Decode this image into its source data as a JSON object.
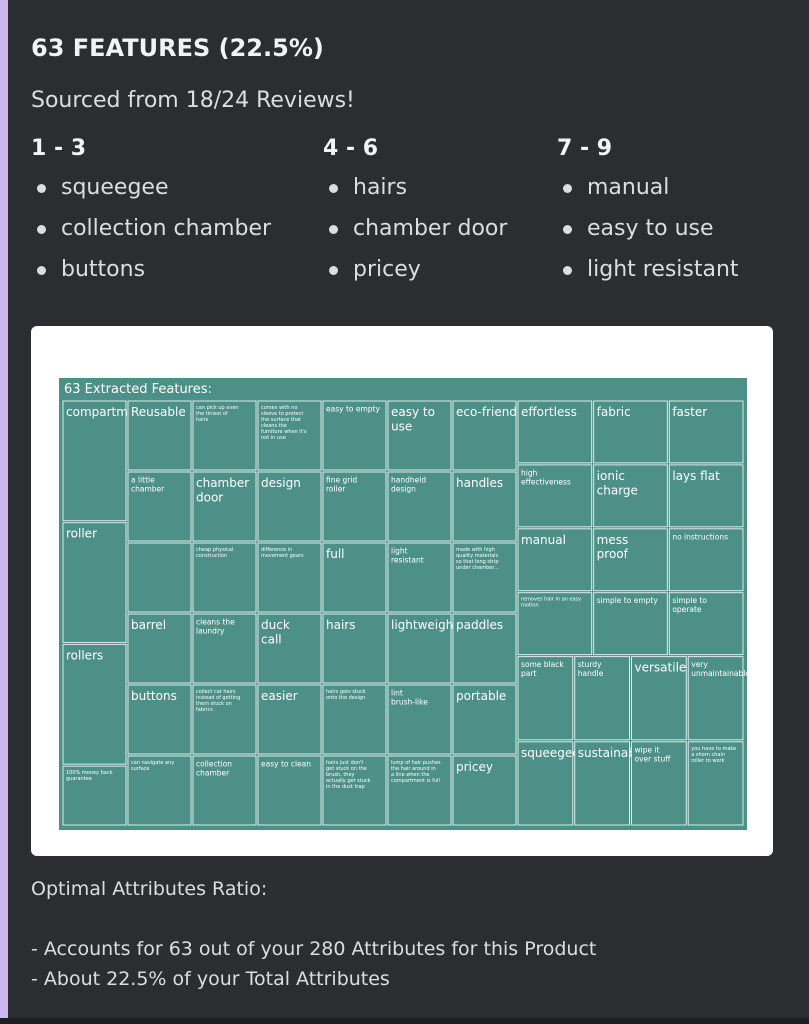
{
  "embed": {
    "title": "63 FEATURES (22.5%)",
    "subtitle": "Sourced from 18/24 Reviews!",
    "columns": [
      {
        "heading": "1 - 3",
        "items": [
          "squeegee",
          "collection chamber",
          "buttons"
        ]
      },
      {
        "heading": "4 - 6",
        "items": [
          "hairs",
          "chamber door",
          "pricey"
        ]
      },
      {
        "heading": "7 - 9",
        "items": [
          "manual",
          "easy to use",
          "light resistant"
        ]
      }
    ],
    "footer": {
      "heading": "Optimal Attributes Ratio:",
      "lines": [
        "- Accounts for 63 out of your 280 Attributes for this Product",
        "- About 22.5% of your Total Attributes"
      ]
    },
    "colors": {
      "accent": "#cbb8ef",
      "treemap": "#4d9087",
      "background": "#2b2d31"
    }
  },
  "chart_data": {
    "type": "treemap",
    "title": "63 Extracted Features:",
    "columns": [
      {
        "items": [
          {
            "label": "compartment",
            "value": 8
          },
          {
            "label": "roller",
            "value": 8
          },
          {
            "label": "rollers",
            "value": 8
          },
          {
            "label": "100% money back guarantee",
            "value": 4
          }
        ]
      },
      {
        "items": [
          {
            "label": "Reusable",
            "value": 4
          },
          {
            "label": "a little chamber",
            "value": 4
          },
          {
            "label": "",
            "value": 4
          },
          {
            "label": "barrel",
            "value": 4
          },
          {
            "label": "buttons",
            "value": 4
          },
          {
            "label": "can navigate any surface",
            "value": 4
          }
        ]
      },
      {
        "items": [
          {
            "label": "can pick up even the tiniest of hairs",
            "value": 4
          },
          {
            "label": "chamber door",
            "value": 4
          },
          {
            "label": "cheap physical construction",
            "value": 4
          },
          {
            "label": "cleans the laundry",
            "value": 4
          },
          {
            "label": "collect cat hairs instead of getting them stuck on fabrics",
            "value": 4
          },
          {
            "label": "collection chamber",
            "value": 4
          }
        ]
      },
      {
        "items": [
          {
            "label": "comes with no sleeve to protect the surface that cleans the furniture when it's not in use",
            "value": 4
          },
          {
            "label": "design",
            "value": 4
          },
          {
            "label": "difference in movement gears",
            "value": 4
          },
          {
            "label": "duck call",
            "value": 4
          },
          {
            "label": "easier",
            "value": 4
          },
          {
            "label": "easy to clean",
            "value": 4
          }
        ]
      },
      {
        "items": [
          {
            "label": "easy to empty",
            "value": 4
          },
          {
            "label": "fine grid roller",
            "value": 4
          },
          {
            "label": "full",
            "value": 4
          },
          {
            "label": "hairs",
            "value": 4
          },
          {
            "label": "hairs gets stuck onto the design",
            "value": 4
          },
          {
            "label": "hairs just don't get stuck on the brush, they actually get stuck in the dust trap",
            "value": 4
          }
        ]
      },
      {
        "items": [
          {
            "label": "easy to use",
            "value": 4
          },
          {
            "label": "handheld design",
            "value": 4
          },
          {
            "label": "light resistant",
            "value": 4
          },
          {
            "label": "lightweight",
            "value": 4
          },
          {
            "label": "lint brush-like",
            "value": 4
          },
          {
            "label": "lump of hair pushes the hair around in a line when the compartment is full",
            "value": 4
          }
        ]
      },
      {
        "items": [
          {
            "label": "eco-friendly",
            "value": 4
          },
          {
            "label": "handles",
            "value": 4
          },
          {
            "label": "made with high quality materials so that long strip under chamber...",
            "value": 4
          },
          {
            "label": "paddles",
            "value": 4
          },
          {
            "label": "portable",
            "value": 4
          },
          {
            "label": "pricey",
            "value": 4
          }
        ]
      }
    ],
    "right_rows": [
      {
        "items": [
          {
            "label": "effortless",
            "value": 4
          },
          {
            "label": "fabric",
            "value": 4
          },
          {
            "label": "faster",
            "value": 4
          }
        ]
      },
      {
        "items": [
          {
            "label": "high effectiveness",
            "value": 4
          },
          {
            "label": "ionic charge",
            "value": 4
          },
          {
            "label": "lays flat",
            "value": 4
          }
        ]
      },
      {
        "items": [
          {
            "label": "manual",
            "value": 4
          },
          {
            "label": "mess proof",
            "value": 4
          },
          {
            "label": "no instructions",
            "value": 4
          }
        ]
      },
      {
        "items": [
          {
            "label": "removes hair in an easy motion",
            "value": 4
          },
          {
            "label": "simple to empty",
            "value": 4
          },
          {
            "label": "simple to operate",
            "value": 4
          }
        ]
      },
      {
        "items": [
          {
            "label": "some black part",
            "value": 4
          },
          {
            "label": "sturdy handle",
            "value": 4
          },
          {
            "label": "versatile",
            "value": 4
          },
          {
            "label": "very unmaintainable",
            "value": 4
          }
        ]
      },
      {
        "items": [
          {
            "label": "squeegee",
            "value": 4
          },
          {
            "label": "sustainable",
            "value": 4
          },
          {
            "label": "wipe it over stuff",
            "value": 4
          },
          {
            "label": "you have to make a shorn chain roller to work",
            "value": 4
          }
        ]
      }
    ]
  }
}
